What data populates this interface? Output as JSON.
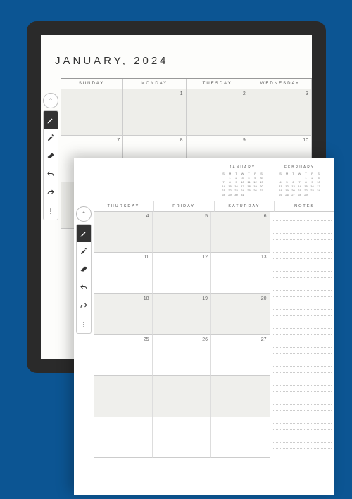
{
  "page1": {
    "title": "JANUARY, 2024",
    "headers": [
      "SUNDAY",
      "MONDAY",
      "TUESDAY",
      "WEDNESDAY"
    ],
    "rows": [
      {
        "shaded": true,
        "days": [
          "",
          "1",
          "2",
          "3"
        ]
      },
      {
        "shaded": false,
        "days": [
          "7",
          "8",
          "9",
          "10"
        ]
      },
      {
        "shaded": true,
        "days": [
          "",
          "",
          "",
          ""
        ]
      }
    ]
  },
  "toolbar": {
    "collapse": "⌃",
    "items": [
      {
        "name": "pen-icon",
        "active": true
      },
      {
        "name": "highlighter-icon",
        "active": false
      },
      {
        "name": "eraser-icon",
        "active": false
      },
      {
        "name": "undo-icon",
        "active": false
      },
      {
        "name": "redo-icon",
        "active": false
      },
      {
        "name": "more-icon",
        "active": false
      }
    ]
  },
  "page2": {
    "mini_calendars": [
      {
        "title": "JANUARY",
        "dow": [
          "S",
          "M",
          "T",
          "W",
          "T",
          "F",
          "S"
        ],
        "weeks": [
          [
            "",
            "1",
            "2",
            "3",
            "4",
            "5",
            "6"
          ],
          [
            "7",
            "8",
            "9",
            "10",
            "11",
            "12",
            "13"
          ],
          [
            "14",
            "15",
            "16",
            "17",
            "18",
            "19",
            "20"
          ],
          [
            "21",
            "22",
            "23",
            "24",
            "25",
            "26",
            "27"
          ],
          [
            "28",
            "29",
            "30",
            "31",
            "",
            "",
            ""
          ]
        ]
      },
      {
        "title": "FEBRUARY",
        "dow": [
          "S",
          "M",
          "T",
          "W",
          "T",
          "F",
          "S"
        ],
        "weeks": [
          [
            "",
            "",
            "",
            "",
            "1",
            "2",
            "3"
          ],
          [
            "4",
            "5",
            "6",
            "7",
            "8",
            "9",
            "10"
          ],
          [
            "11",
            "12",
            "13",
            "14",
            "15",
            "16",
            "17"
          ],
          [
            "18",
            "19",
            "20",
            "21",
            "22",
            "23",
            "24"
          ],
          [
            "25",
            "26",
            "27",
            "28",
            "29",
            "",
            ""
          ]
        ]
      }
    ],
    "headers": [
      "THURSDAY",
      "FRIDAY",
      "SATURDAY",
      "NOTES"
    ],
    "rows": [
      {
        "shaded": true,
        "days": [
          "4",
          "5",
          "6"
        ]
      },
      {
        "shaded": false,
        "days": [
          "11",
          "12",
          "13"
        ]
      },
      {
        "shaded": true,
        "days": [
          "18",
          "19",
          "20"
        ]
      },
      {
        "shaded": false,
        "days": [
          "25",
          "26",
          "27"
        ]
      },
      {
        "shaded": true,
        "days": [
          "",
          "",
          ""
        ]
      },
      {
        "shaded": false,
        "days": [
          "",
          "",
          ""
        ]
      }
    ]
  }
}
